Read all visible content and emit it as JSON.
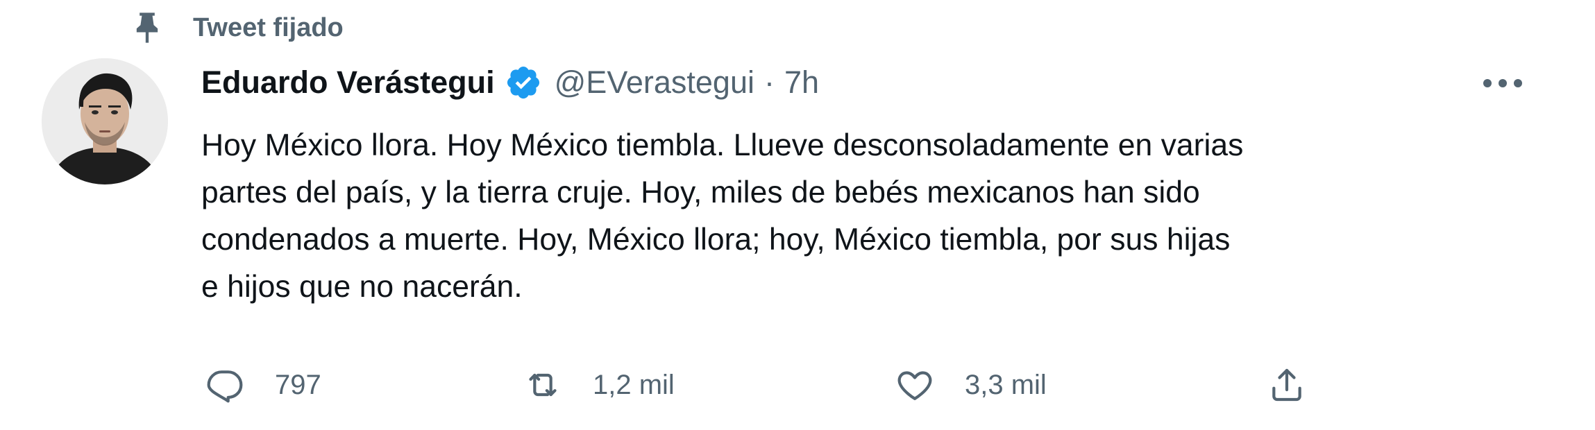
{
  "pinned": {
    "label": "Tweet fijado",
    "icon": "pin-icon"
  },
  "author": {
    "display_name": "Eduardo Verástegui",
    "handle": "@EVerastegui",
    "separator": "·",
    "time": "7h",
    "verified": true,
    "verified_color": "#1d9bf0"
  },
  "tweet": {
    "lines": [
      "Hoy México llora. Hoy México tiembla. Llueve desconsoladamente en varias",
      "partes del país, y la tierra cruje. Hoy, miles de bebés mexicanos han sido",
      "condenados a muerte. Hoy, México llora; hoy, México tiembla, por sus hijas",
      "e hijos que no nacerán."
    ]
  },
  "actions": {
    "reply": {
      "icon": "reply-icon",
      "count": "797"
    },
    "retweet": {
      "icon": "retweet-icon",
      "count": "1,2 mil"
    },
    "like": {
      "icon": "heart-icon",
      "count": "3,3 mil"
    },
    "share": {
      "icon": "share-icon"
    }
  },
  "colors": {
    "text": "#0f1419",
    "secondary": "#536471",
    "verified": "#1d9bf0",
    "background": "#ffffff"
  }
}
